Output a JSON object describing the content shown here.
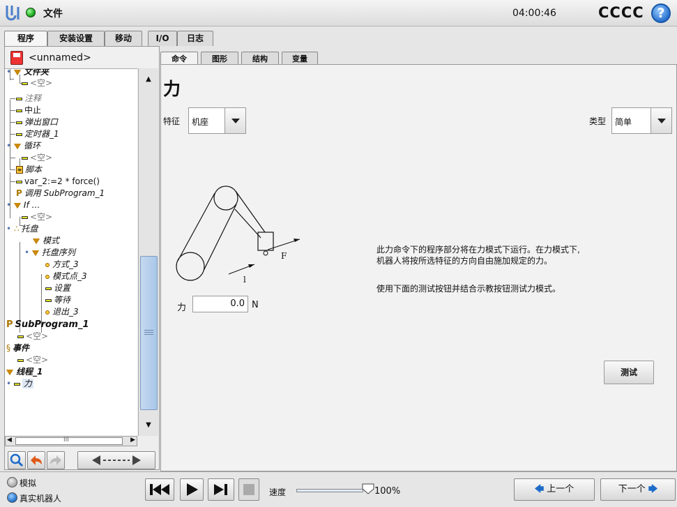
{
  "topbar": {
    "file_menu": "文件",
    "clock": "04:00:46",
    "robot_name": "CCCC",
    "help_icon": "?"
  },
  "main_tabs": [
    {
      "label": "程序",
      "active": true
    },
    {
      "label": "安装设置",
      "active": false
    },
    {
      "label": "移动",
      "active": false
    },
    {
      "label": "I/O",
      "active": false
    },
    {
      "label": "日志",
      "active": false
    }
  ],
  "program": {
    "name": "<unnamed>"
  },
  "tree": [
    {
      "label": "文件夹",
      "italic": true,
      "bold": true,
      "icon": "folder-triangle-icon"
    },
    {
      "label": "<空>",
      "gray": true,
      "icon": "empty-bar-icon"
    },
    {
      "label": "注释",
      "gray": true,
      "icon": "comment-bar-icon"
    },
    {
      "label": "中止",
      "icon": "halt-bar-icon"
    },
    {
      "label": "弹出窗口",
      "italic": true,
      "icon": "popup-bar-icon"
    },
    {
      "label": "定时器_1",
      "italic": true,
      "icon": "timer-bar-icon"
    },
    {
      "label": "循环",
      "italic": true,
      "icon": "loop-triangle-icon"
    },
    {
      "label": "<空>",
      "gray": true,
      "icon": "empty-bar-icon"
    },
    {
      "label": "脚本",
      "italic": true,
      "icon": "script-icon"
    },
    {
      "label": "var_2:=2 * force()",
      "icon": "assignment-bar-icon"
    },
    {
      "label": "调用 SubProgram_1",
      "italic": true,
      "icon": "call-icon"
    },
    {
      "label": "If …",
      "italic": true,
      "icon": "if-triangle-icon"
    },
    {
      "label": "<空>",
      "gray": true,
      "icon": "empty-bar-icon"
    },
    {
      "label": "托盘",
      "italic": true,
      "icon": "pallet-icon"
    },
    {
      "label": "模式",
      "italic": true,
      "icon": "pattern-triangle-icon"
    },
    {
      "label": "托盘序列",
      "italic": true,
      "icon": "sequence-triangle-icon"
    },
    {
      "label": "方式_3",
      "italic": true,
      "icon": "waypoint-dot-icon"
    },
    {
      "label": "模式点_3",
      "italic": true,
      "icon": "waypoint-dot-icon"
    },
    {
      "label": "设置",
      "italic": true,
      "icon": "set-bar-icon"
    },
    {
      "label": "等待",
      "italic": true,
      "icon": "wait-bar-icon"
    },
    {
      "label": "退出_3",
      "italic": true,
      "icon": "waypoint-dot-icon"
    },
    {
      "label": "SubProgram_1",
      "italic": true,
      "bold": true,
      "icon": "subprogram-icon"
    },
    {
      "label": "<空>",
      "gray": true,
      "icon": "empty-bar-icon"
    },
    {
      "label": "事件",
      "italic": true,
      "bold": true,
      "icon": "event-icon"
    },
    {
      "label": "<空>",
      "gray": true,
      "icon": "empty-bar-icon"
    },
    {
      "label": "线程_1",
      "italic": true,
      "bold": true,
      "icon": "thread-triangle-icon"
    },
    {
      "label": "力",
      "italic": true,
      "icon": "force-bar-icon",
      "selected": true
    }
  ],
  "hscroll_label": "III",
  "sub_tabs": [
    {
      "label": "命令",
      "active": true
    },
    {
      "label": "图形",
      "active": false
    },
    {
      "label": "结构",
      "active": false
    },
    {
      "label": "变量",
      "active": false
    }
  ],
  "force_cmd": {
    "title": "力",
    "feature_label": "特征",
    "feature_value": "机座",
    "type_label": "类型",
    "type_value": "简单",
    "diagram_F": "F",
    "diagram_l": "l",
    "force_label": "力",
    "force_value": "0.0",
    "force_unit": "N",
    "description_line1": "此力命令下的程序部分将在力模式下运行。在力模式下,",
    "description_line2": "机器人将按所选特征的方向自由施加规定的力。",
    "description_line3": "使用下面的测试按钮并结合示教按钮测试力模式。",
    "test_button": "测试"
  },
  "bottom": {
    "sim_label": "模拟",
    "real_label": "真实机器人",
    "speed_label": "速度",
    "speed_value": "100%",
    "speed_fraction": 1.0,
    "prev_label": "上一个",
    "next_label": "下一个"
  },
  "colors": {
    "accent_blue": "#1d6cc8",
    "tree_icon_yellow": "#e8d400",
    "triangle_orange": "#c88000"
  }
}
